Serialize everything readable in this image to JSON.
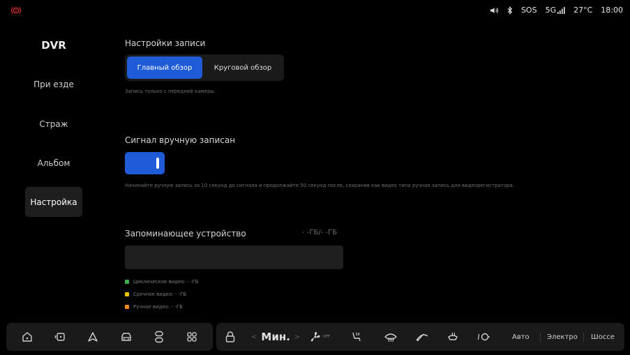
{
  "status": {
    "sos": "SOS",
    "network": "5G",
    "temperature": "27°C",
    "time": "18:00"
  },
  "nav": {
    "title": "DVR",
    "items": [
      {
        "label": "При езде",
        "active": false
      },
      {
        "label": "Страж",
        "active": false
      },
      {
        "label": "Альбом",
        "active": false
      },
      {
        "label": "Настройка",
        "active": true
      }
    ]
  },
  "recording": {
    "title": "Настройки записи",
    "options": [
      "Главный обзор",
      "Круговой обзор"
    ],
    "selected": "Главный обзор",
    "hint": "Запись только с передней камеры"
  },
  "manual": {
    "title": "Сигнал вручную записан",
    "toggle_on": true,
    "hint": "Начинайте ручную запись за 10 секунд до сигнала и продолжайте 50 секунд после, сохраняя как видео типа ручная запись для видеорегистратора."
  },
  "storage": {
    "title": "Запоминающее устройство",
    "value": "- -ГБ/- -ГБ",
    "legend": [
      {
        "label": "Циклическое видео: - -ГБ",
        "color": "#3fae49"
      },
      {
        "label": "Срочное видео: - -ГБ",
        "color": "#f2c200"
      },
      {
        "label": "Ручное видео: - -ГБ",
        "color": "#f08a1c"
      }
    ]
  },
  "dock": {
    "fan_level": "Мин.",
    "fan_off": "OFF",
    "modes": [
      "Авто",
      "Электро",
      "Шоссе"
    ]
  },
  "colors": {
    "accent": "#1f5bd6",
    "background": "#000000",
    "brake_warning": "#e0302b"
  }
}
